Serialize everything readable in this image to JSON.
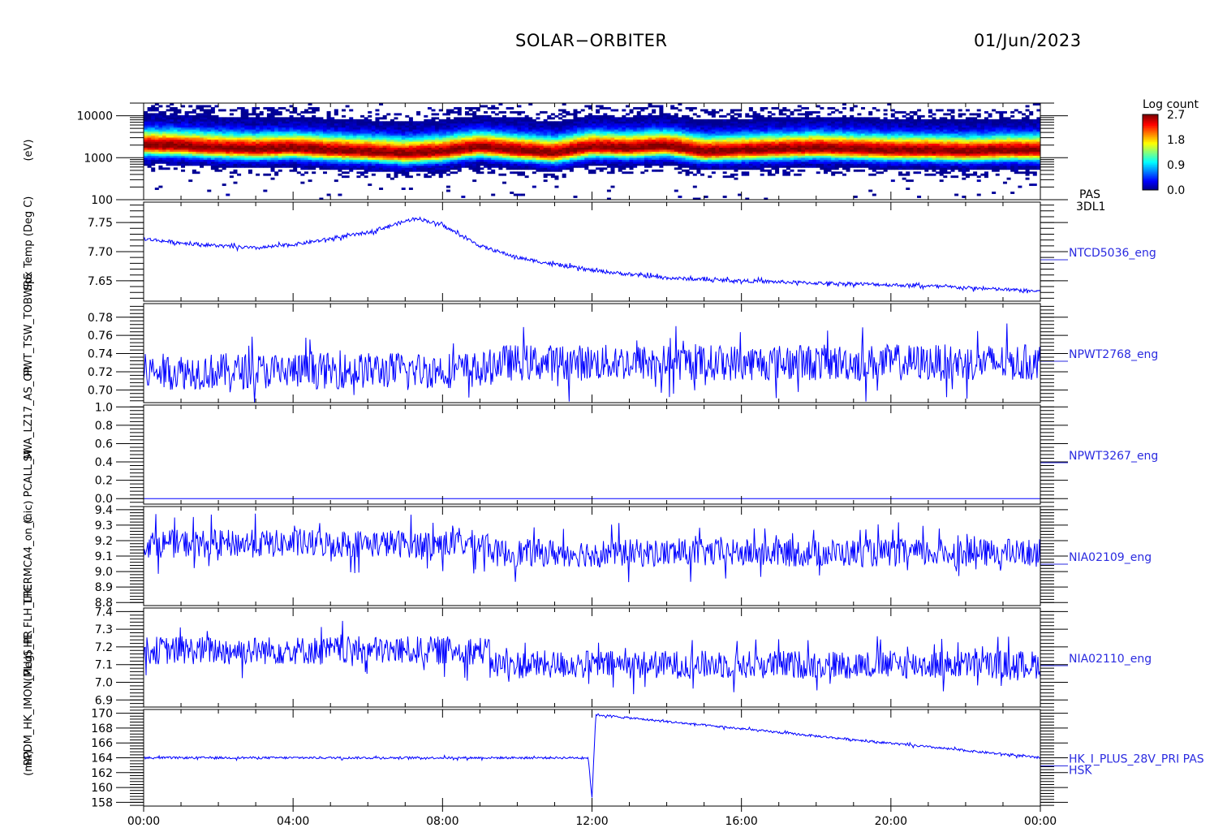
{
  "header": {
    "title": "SOLAR−ORBITER",
    "date": "01/Jun/2023"
  },
  "colorbar": {
    "title": "Log count",
    "ticks": [
      "2.7",
      "1.8",
      "0.9",
      "0.0"
    ],
    "values": [
      2.7,
      1.8,
      0.9,
      0.0
    ]
  },
  "colors": {
    "series": "#0000ff",
    "label": "#2a2ae0",
    "axis": "#000000"
  },
  "chart_data": [
    {
      "type": "heatmap",
      "ylog": true,
      "ylim": [
        100,
        20000
      ],
      "yticks": [
        "10000",
        "1000",
        "100"
      ],
      "ytick_values": [
        10000,
        1000,
        100
      ],
      "ylabel": "(eV)",
      "labels": [
        "PAS",
        "3DL1"
      ],
      "peak_energy_ev": [
        2000,
        1900,
        1700,
        1600,
        1700,
        1500,
        1400,
        1250,
        1400,
        1800,
        1500,
        1300,
        1800,
        1700,
        1900,
        1400,
        1500,
        1600,
        1700,
        1600,
        1500,
        1500,
        1400,
        1500,
        1500
      ],
      "max_log_count": 2.7
    },
    {
      "type": "line",
      "label": "NTCD5036_eng",
      "ylim": [
        7.615,
        7.785
      ],
      "yticks": [
        "7.75",
        "7.70",
        "7.65"
      ],
      "ytick_values": [
        7.75,
        7.7,
        7.65
      ],
      "x_hours": [
        0,
        1,
        2,
        3,
        4,
        5,
        6,
        7,
        7.3,
        8,
        9,
        10,
        11,
        12,
        13,
        14,
        15,
        16,
        17,
        18,
        19,
        20,
        21,
        22,
        23,
        24
      ],
      "values": [
        7.722,
        7.715,
        7.71,
        7.706,
        7.712,
        7.722,
        7.733,
        7.752,
        7.758,
        7.745,
        7.71,
        7.69,
        7.678,
        7.668,
        7.661,
        7.655,
        7.652,
        7.65,
        7.648,
        7.646,
        7.645,
        7.643,
        7.641,
        7.638,
        7.635,
        7.632
      ],
      "noise": 0.003
    },
    {
      "type": "line",
      "label": "NPWT2768_eng",
      "ylim": [
        0.686,
        0.795
      ],
      "yticks": [
        "0.78",
        "0.76",
        "0.74",
        "0.72",
        "0.70"
      ],
      "ytick_values": [
        0.78,
        0.76,
        0.74,
        0.72,
        0.7
      ],
      "x_hours": [
        0,
        9.2,
        9.4,
        24
      ],
      "values": [
        0.72,
        0.722,
        0.73,
        0.73
      ],
      "noise": 0.02
    },
    {
      "type": "line",
      "label": "NPWT3267_eng",
      "ylim": [
        -0.06,
        1.02
      ],
      "yticks": [
        "1.0",
        "0.8",
        "0.6",
        "0.4",
        "0.2",
        "0.0"
      ],
      "ytick_values": [
        1.0,
        0.8,
        0.6,
        0.4,
        0.2,
        0.0
      ],
      "x_hours": [
        0,
        24
      ],
      "values": [
        0.0,
        0.0
      ],
      "noise": 0.0
    },
    {
      "type": "line",
      "label": "NIA02109_eng",
      "ylim": [
        8.78,
        9.42
      ],
      "yticks": [
        "9.4",
        "9.3",
        "9.2",
        "9.1",
        "9.0",
        "8.9",
        "8.8"
      ],
      "ytick_values": [
        9.4,
        9.3,
        9.2,
        9.1,
        9.0,
        8.9,
        8.8
      ],
      "x_hours": [
        0,
        9.2,
        9.4,
        24
      ],
      "values": [
        9.18,
        9.18,
        9.12,
        9.12
      ],
      "noise": 0.09
    },
    {
      "type": "line",
      "label": "NIA02110_eng",
      "ylim": [
        6.86,
        7.42
      ],
      "yticks": [
        "7.4",
        "7.3",
        "7.2",
        "7.1",
        "7.0",
        "6.9"
      ],
      "ytick_values": [
        7.4,
        7.3,
        7.2,
        7.1,
        7.0,
        6.9
      ],
      "x_hours": [
        0,
        9.2,
        9.4,
        24
      ],
      "values": [
        7.18,
        7.18,
        7.1,
        7.1
      ],
      "noise": 0.08
    },
    {
      "type": "line",
      "label": "HK_I_PLUS_28V_PRI PAS",
      "label2": "HSK",
      "ylim": [
        157.5,
        170.5
      ],
      "yticks": [
        "170",
        "168",
        "166",
        "164",
        "162",
        "160",
        "158"
      ],
      "ytick_values": [
        170,
        168,
        166,
        164,
        162,
        160,
        158
      ],
      "x_hours": [
        0,
        11.9,
        12.0,
        12.1,
        24
      ],
      "values": [
        164.0,
        164.0,
        158.5,
        169.8,
        164.0
      ],
      "noise": 0.15
    }
  ],
  "xaxis": {
    "ticks": [
      "00:00",
      "04:00",
      "08:00",
      "12:00",
      "16:00",
      "20:00",
      "00:00"
    ],
    "hours": [
      0,
      4,
      8,
      12,
      16,
      20,
      24
    ]
  },
  "ylabels": [
    "(eV)",
    "Spx Temp (Deg C)",
    "PWT_TSW_TOBWRE",
    "SWA_LZ17_AS_OP",
    "(nic) PCALL_M",
    "THERMCA4_on_C",
    "(Meg) HE_FLH_LTC",
    "RPDM_HK_IMON_PLUS_PR",
    "(mA)"
  ]
}
